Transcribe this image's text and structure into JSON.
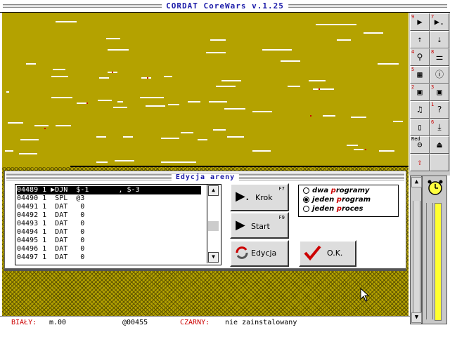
{
  "app": {
    "title": "CORDAT CoreWars v.1.25"
  },
  "toolbar": {
    "buttons": [
      {
        "name": "step-back",
        "num": "9",
        "glyph": "▶",
        "icon": "play-icon"
      },
      {
        "name": "step-dot",
        "num": "7",
        "glyph": "▶.",
        "icon": "step-icon"
      },
      {
        "name": "arrow-up",
        "num": "",
        "glyph": "⇡",
        "icon": "arrow-up-icon"
      },
      {
        "name": "arrow-down",
        "num": "",
        "glyph": "⇣",
        "icon": "arrow-down-icon"
      },
      {
        "name": "search",
        "num": "4",
        "glyph": "⚲",
        "icon": "magnifier-icon"
      },
      {
        "name": "broom",
        "num": "8",
        "glyph": "⚌",
        "icon": "broom-icon"
      },
      {
        "name": "calc",
        "num": "5",
        "glyph": "▦",
        "icon": "calculator-icon"
      },
      {
        "name": "info",
        "num": "",
        "glyph": "ⓘ",
        "icon": "info-icon"
      },
      {
        "name": "disk-1",
        "num": "2",
        "glyph": "▣",
        "icon": "disk-icon"
      },
      {
        "name": "disk-2",
        "num": "3",
        "glyph": "▣",
        "icon": "disk-icon"
      },
      {
        "name": "music",
        "num": "",
        "glyph": "♫",
        "icon": "music-icon"
      },
      {
        "name": "help",
        "num": "1",
        "glyph": "?",
        "icon": "help-icon"
      },
      {
        "name": "trash",
        "num": "",
        "glyph": "▯",
        "icon": "trash-icon"
      },
      {
        "name": "download",
        "num": "6",
        "glyph": "⤓",
        "icon": "download-icon"
      },
      {
        "name": "red-car",
        "num": "",
        "label": "Red",
        "glyph": "⊖",
        "icon": "car-icon"
      },
      {
        "name": "eject",
        "num": "",
        "glyph": "⏏",
        "icon": "eject-icon"
      },
      {
        "name": "export",
        "num": "",
        "glyph": "⇪",
        "icon": "upload-icon"
      },
      {
        "name": "blank",
        "num": "",
        "glyph": "",
        "icon": ""
      }
    ]
  },
  "dialog": {
    "title": "Edycja areny",
    "code_rows": [
      {
        "text": "04489 1 ▶DJN  $-1       , $-3",
        "selected": true
      },
      {
        "text": "04490 1  SPL  @3",
        "selected": false
      },
      {
        "text": "04491 1  DAT   0",
        "selected": false
      },
      {
        "text": "04492 1  DAT   0",
        "selected": false
      },
      {
        "text": "04493 1  DAT   0",
        "selected": false
      },
      {
        "text": "04494 1  DAT   0",
        "selected": false
      },
      {
        "text": "04495 1  DAT   0",
        "selected": false
      },
      {
        "text": "04496 1  DAT   0",
        "selected": false
      },
      {
        "text": "04497 1  DAT   0",
        "selected": false
      }
    ],
    "buttons": {
      "krok": {
        "label": "Krok",
        "key": "F7"
      },
      "start": {
        "label": "Start",
        "key": "F9"
      },
      "edycja": {
        "label": "Edycja"
      },
      "ok": {
        "label": "O.K."
      }
    },
    "radios": [
      {
        "label": "dwa programy",
        "selected": false
      },
      {
        "label": "jeden program",
        "selected": true
      },
      {
        "label": "jeden proces",
        "selected": false
      }
    ]
  },
  "status": {
    "white_label": "BIAŁY:",
    "white_value": "m.00",
    "address": "@00455",
    "black_label": "CZARNY:",
    "black_value": "nie zainstalowany"
  }
}
